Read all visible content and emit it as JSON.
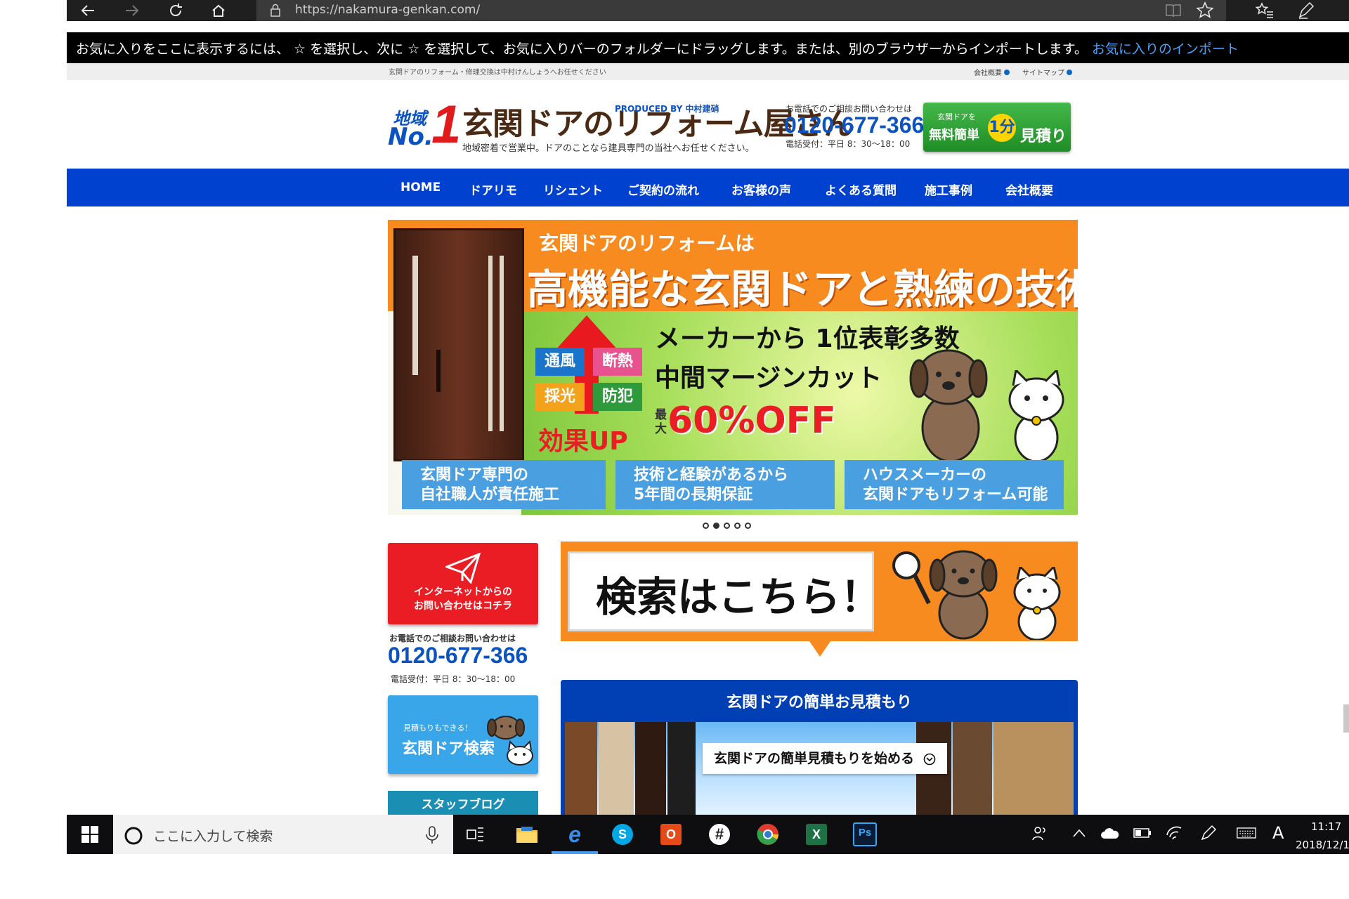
{
  "browser": {
    "url": "https://nakamura-genkan.com/",
    "favorites_hint": "お気に入りをここに表示するには、 ☆ を選択し、次に ☆ を選択して、お気に入りバーのフォルダーにドラッグします。または、別のブラウザーからインポートします。",
    "favorites_link": "お気に入りのインポート"
  },
  "site": {
    "strip": {
      "tagline": "玄関ドアのリフォーム・修理交換は中村けんしょうへお任せください",
      "company_link": "会社概要",
      "sitemap_link": "サイトマップ"
    },
    "header": {
      "logo_area": "地域",
      "logo_no": "No.",
      "logo_one": "1",
      "logo_main": "玄関ドアのリフォーム屋さん",
      "logo_produced": "PRODUCED BY 中村建硝",
      "logo_sub": "地域密着で営業中。ドアのことなら建具専門の当社へお任せください。",
      "phone_label": "お電話でのご相談お問い合わせは",
      "phone": "0120-677-366",
      "hours": "電話受付：平日 8：30〜18：00",
      "estimate_small": "玄関ドアを",
      "estimate_main": "無料簡単",
      "estimate_min": "1分",
      "estimate_end": "見積り"
    },
    "nav": [
      "HOME",
      "ドアリモ",
      "リシェント",
      "ご契約の流れ",
      "お客様の声",
      "よくある質問",
      "施工事例",
      "会社概要"
    ],
    "hero": {
      "line1": "玄関ドアのリフォームは",
      "line2": "高機能な玄関ドアと熟練の技術で",
      "line3": "メーカーから 1位表彰多数",
      "line4": "中間マージンカット",
      "max": "最大",
      "discount": "60%OFF",
      "tags": [
        {
          "label": "通風",
          "color": "#1a74c9"
        },
        {
          "label": "断熱",
          "color": "#e8528f"
        },
        {
          "label": "採光",
          "color": "#f2a21b"
        },
        {
          "label": "防犯",
          "color": "#2e9a3c"
        }
      ],
      "effect": "効果UP",
      "boxes": [
        [
          "玄関ドア専門の",
          "自社職人が責任施工"
        ],
        [
          "技術と経験があるから",
          "5年間の長期保証"
        ],
        [
          "ハウスメーカーの",
          "玄関ドアもリフォーム可能"
        ]
      ]
    },
    "carousel": {
      "total": 5,
      "active": 2
    },
    "left": {
      "contact_line1": "インターネットからの",
      "contact_line2": "お問い合わせはコチラ",
      "phone_label": "お電話でのご相談お問い合わせは",
      "phone": "0120-677-366",
      "hours": "電話受付：平日 8：30〜18：00",
      "search_small": "見積もりもできる！",
      "search_main": "玄関ドア検索",
      "blog": "スタッフブログ"
    },
    "right": {
      "search_banner": "検索はこちら！",
      "estimate_title": "玄関ドアの簡単お見積もり",
      "estimate_start": "玄関ドアの簡単見積もりを始める"
    }
  },
  "taskbar": {
    "search_placeholder": "ここに入力して検索",
    "ime": "A",
    "time": "11:17",
    "date": "2018/12/1"
  },
  "colors": {
    "nav_blue": "#0041d0",
    "brand_orange": "#f78b1f",
    "accent_red": "#ea1c24",
    "phone_blue": "#0b53c1"
  }
}
